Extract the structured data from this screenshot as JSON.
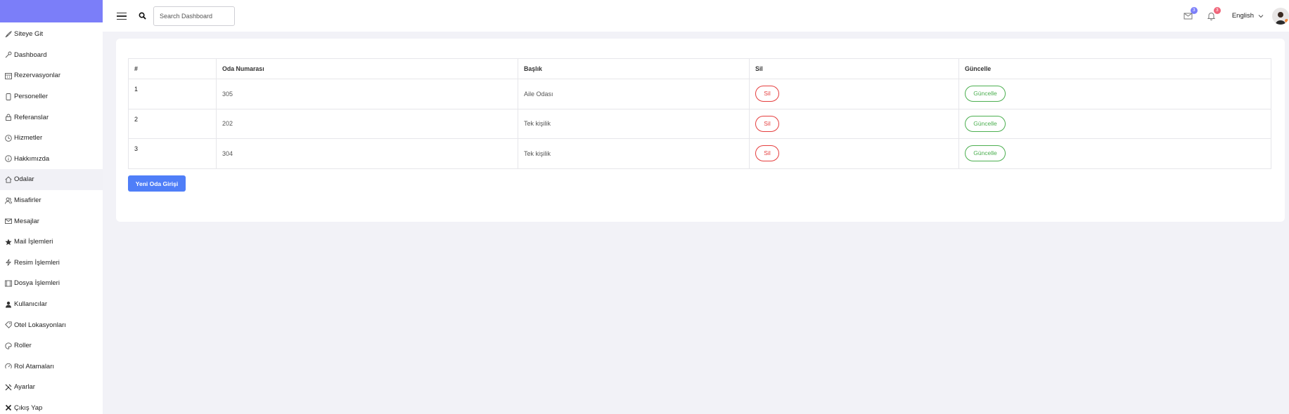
{
  "sidebar": {
    "items": [
      {
        "label": "Siteye Git",
        "icon": "rocket-icon"
      },
      {
        "label": "Dashboard",
        "icon": "key-icon"
      },
      {
        "label": "Rezervasyonlar",
        "icon": "calendar-icon"
      },
      {
        "label": "Personeller",
        "icon": "phone-icon"
      },
      {
        "label": "Referanslar",
        "icon": "lock-icon"
      },
      {
        "label": "Hizmetler",
        "icon": "clock-icon"
      },
      {
        "label": "Hakkımızda",
        "icon": "info-icon"
      },
      {
        "label": "Odalar",
        "icon": "home-icon"
      },
      {
        "label": "Misafirler",
        "icon": "users-icon"
      },
      {
        "label": "Mesajlar",
        "icon": "mail-icon"
      },
      {
        "label": "Mail İşlemleri",
        "icon": "star-icon"
      },
      {
        "label": "Resim İşlemleri",
        "icon": "bolt-icon"
      },
      {
        "label": "Dosya İşlemleri",
        "icon": "film-icon"
      },
      {
        "label": "Kullanıcılar",
        "icon": "user-icon"
      },
      {
        "label": "Otel Lokasyonları",
        "icon": "tag-icon"
      },
      {
        "label": "Roller",
        "icon": "palette-icon"
      },
      {
        "label": "Rol Atamaları",
        "icon": "gauge-icon"
      },
      {
        "label": "Ayarlar",
        "icon": "tools-icon"
      },
      {
        "label": "Çıkış Yap",
        "icon": "close-icon"
      }
    ],
    "active_index": 7
  },
  "header": {
    "search_placeholder": "Search Dashboard",
    "mail_badge": "3",
    "notification_badge": "3",
    "language": "English",
    "colors": {
      "mail_badge": "#7b7ef9",
      "notification_badge": "#f0657a"
    }
  },
  "table": {
    "columns": [
      "#",
      "Oda Numarası",
      "Başlık",
      "Sil",
      "Güncelle"
    ],
    "rows": [
      {
        "index": "1",
        "room_number": "305",
        "title": "Aile Odası",
        "delete_label": "Sil",
        "update_label": "Güncelle"
      },
      {
        "index": "2",
        "room_number": "202",
        "title": "Tek kişilik",
        "delete_label": "Sil",
        "update_label": "Güncelle"
      },
      {
        "index": "3",
        "room_number": "304",
        "title": "Tek kişilik",
        "delete_label": "Sil",
        "update_label": "Güncelle"
      }
    ]
  },
  "actions": {
    "new_room_label": "Yeni Oda Girişi"
  },
  "colors": {
    "brand": "#7b7ef9",
    "primary_button": "#4f7ef8",
    "danger": "#e53e3e",
    "success": "#4caf50",
    "page_background": "#f2f2f7"
  }
}
